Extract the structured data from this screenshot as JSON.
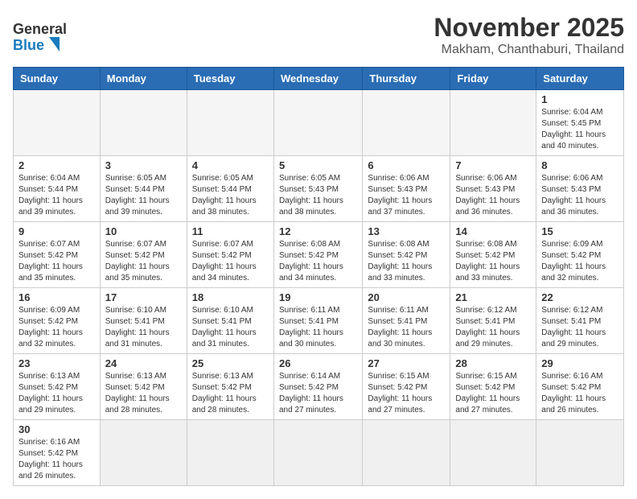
{
  "header": {
    "logo_line1": "General",
    "logo_line2": "Blue",
    "month": "November 2025",
    "location": "Makham, Chanthaburi, Thailand"
  },
  "weekdays": [
    "Sunday",
    "Monday",
    "Tuesday",
    "Wednesday",
    "Thursday",
    "Friday",
    "Saturday"
  ],
  "weeks": [
    [
      {
        "day": "",
        "info": ""
      },
      {
        "day": "",
        "info": ""
      },
      {
        "day": "",
        "info": ""
      },
      {
        "day": "",
        "info": ""
      },
      {
        "day": "",
        "info": ""
      },
      {
        "day": "",
        "info": ""
      },
      {
        "day": "1",
        "info": "Sunrise: 6:04 AM\nSunset: 5:45 PM\nDaylight: 11 hours\nand 40 minutes."
      }
    ],
    [
      {
        "day": "2",
        "info": "Sunrise: 6:04 AM\nSunset: 5:44 PM\nDaylight: 11 hours\nand 39 minutes."
      },
      {
        "day": "3",
        "info": "Sunrise: 6:05 AM\nSunset: 5:44 PM\nDaylight: 11 hours\nand 39 minutes."
      },
      {
        "day": "4",
        "info": "Sunrise: 6:05 AM\nSunset: 5:44 PM\nDaylight: 11 hours\nand 38 minutes."
      },
      {
        "day": "5",
        "info": "Sunrise: 6:05 AM\nSunset: 5:43 PM\nDaylight: 11 hours\nand 38 minutes."
      },
      {
        "day": "6",
        "info": "Sunrise: 6:06 AM\nSunset: 5:43 PM\nDaylight: 11 hours\nand 37 minutes."
      },
      {
        "day": "7",
        "info": "Sunrise: 6:06 AM\nSunset: 5:43 PM\nDaylight: 11 hours\nand 36 minutes."
      },
      {
        "day": "8",
        "info": "Sunrise: 6:06 AM\nSunset: 5:43 PM\nDaylight: 11 hours\nand 36 minutes."
      }
    ],
    [
      {
        "day": "9",
        "info": "Sunrise: 6:07 AM\nSunset: 5:42 PM\nDaylight: 11 hours\nand 35 minutes."
      },
      {
        "day": "10",
        "info": "Sunrise: 6:07 AM\nSunset: 5:42 PM\nDaylight: 11 hours\nand 35 minutes."
      },
      {
        "day": "11",
        "info": "Sunrise: 6:07 AM\nSunset: 5:42 PM\nDaylight: 11 hours\nand 34 minutes."
      },
      {
        "day": "12",
        "info": "Sunrise: 6:08 AM\nSunset: 5:42 PM\nDaylight: 11 hours\nand 34 minutes."
      },
      {
        "day": "13",
        "info": "Sunrise: 6:08 AM\nSunset: 5:42 PM\nDaylight: 11 hours\nand 33 minutes."
      },
      {
        "day": "14",
        "info": "Sunrise: 6:08 AM\nSunset: 5:42 PM\nDaylight: 11 hours\nand 33 minutes."
      },
      {
        "day": "15",
        "info": "Sunrise: 6:09 AM\nSunset: 5:42 PM\nDaylight: 11 hours\nand 32 minutes."
      }
    ],
    [
      {
        "day": "16",
        "info": "Sunrise: 6:09 AM\nSunset: 5:42 PM\nDaylight: 11 hours\nand 32 minutes."
      },
      {
        "day": "17",
        "info": "Sunrise: 6:10 AM\nSunset: 5:41 PM\nDaylight: 11 hours\nand 31 minutes."
      },
      {
        "day": "18",
        "info": "Sunrise: 6:10 AM\nSunset: 5:41 PM\nDaylight: 11 hours\nand 31 minutes."
      },
      {
        "day": "19",
        "info": "Sunrise: 6:11 AM\nSunset: 5:41 PM\nDaylight: 11 hours\nand 30 minutes."
      },
      {
        "day": "20",
        "info": "Sunrise: 6:11 AM\nSunset: 5:41 PM\nDaylight: 11 hours\nand 30 minutes."
      },
      {
        "day": "21",
        "info": "Sunrise: 6:12 AM\nSunset: 5:41 PM\nDaylight: 11 hours\nand 29 minutes."
      },
      {
        "day": "22",
        "info": "Sunrise: 6:12 AM\nSunset: 5:41 PM\nDaylight: 11 hours\nand 29 minutes."
      }
    ],
    [
      {
        "day": "23",
        "info": "Sunrise: 6:13 AM\nSunset: 5:42 PM\nDaylight: 11 hours\nand 29 minutes."
      },
      {
        "day": "24",
        "info": "Sunrise: 6:13 AM\nSunset: 5:42 PM\nDaylight: 11 hours\nand 28 minutes."
      },
      {
        "day": "25",
        "info": "Sunrise: 6:13 AM\nSunset: 5:42 PM\nDaylight: 11 hours\nand 28 minutes."
      },
      {
        "day": "26",
        "info": "Sunrise: 6:14 AM\nSunset: 5:42 PM\nDaylight: 11 hours\nand 27 minutes."
      },
      {
        "day": "27",
        "info": "Sunrise: 6:15 AM\nSunset: 5:42 PM\nDaylight: 11 hours\nand 27 minutes."
      },
      {
        "day": "28",
        "info": "Sunrise: 6:15 AM\nSunset: 5:42 PM\nDaylight: 11 hours\nand 27 minutes."
      },
      {
        "day": "29",
        "info": "Sunrise: 6:16 AM\nSunset: 5:42 PM\nDaylight: 11 hours\nand 26 minutes."
      }
    ],
    [
      {
        "day": "30",
        "info": "Sunrise: 6:16 AM\nSunset: 5:42 PM\nDaylight: 11 hours\nand 26 minutes."
      },
      {
        "day": "",
        "info": ""
      },
      {
        "day": "",
        "info": ""
      },
      {
        "day": "",
        "info": ""
      },
      {
        "day": "",
        "info": ""
      },
      {
        "day": "",
        "info": ""
      },
      {
        "day": "",
        "info": ""
      }
    ]
  ]
}
